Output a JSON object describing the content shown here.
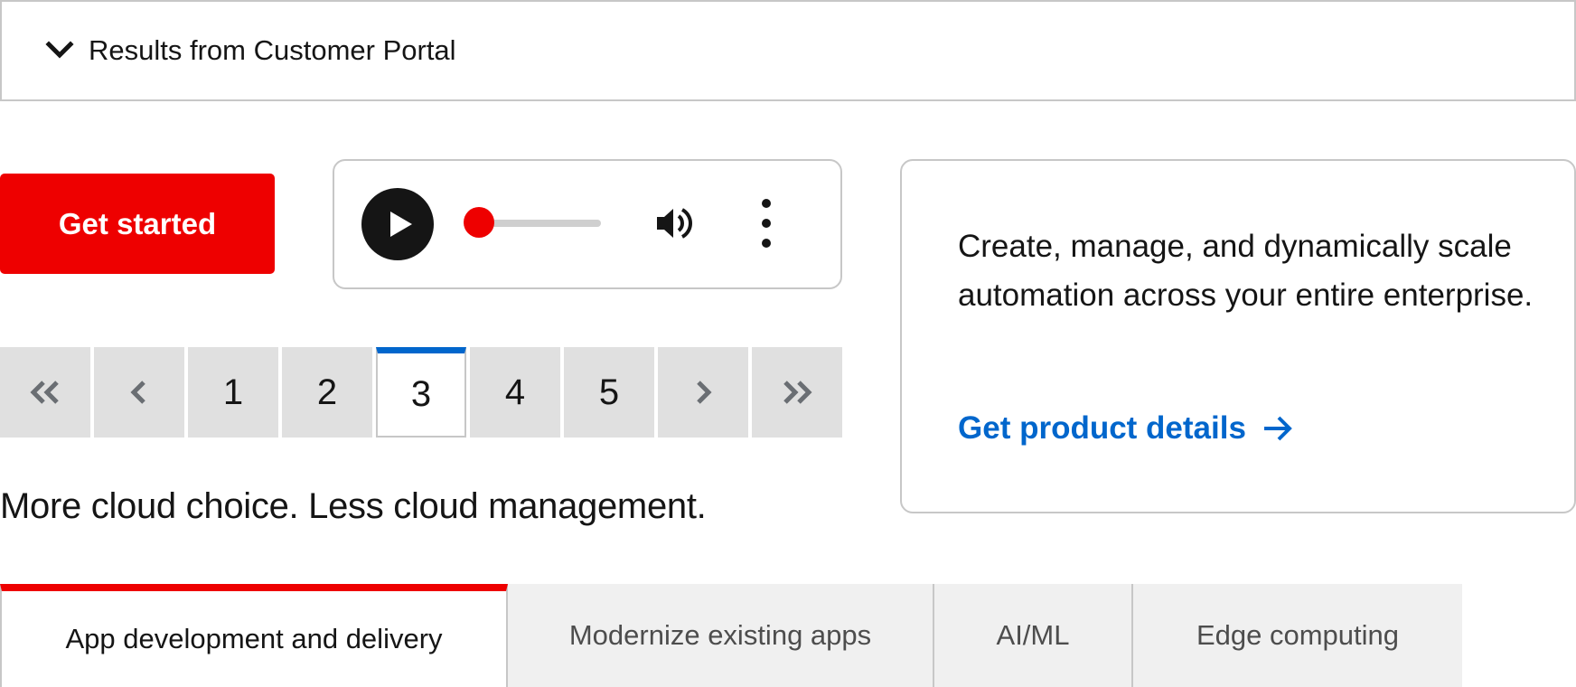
{
  "accordion": {
    "title": "Results from Customer Portal",
    "icon": "chevron-down-icon"
  },
  "cta": {
    "label": "Get started",
    "color": "#ee0000"
  },
  "player": {
    "progress": 0.1,
    "icons": [
      "play-icon",
      "volume-icon",
      "kebab-menu-icon"
    ]
  },
  "pagination": {
    "first_icon": "double-chevron-left-icon",
    "prev_icon": "chevron-left-icon",
    "pages": [
      "1",
      "2",
      "3",
      "4",
      "5"
    ],
    "current": "3",
    "next_icon": "chevron-right-icon",
    "last_icon": "double-chevron-right-icon",
    "accent": "#0066cc"
  },
  "headline": "More cloud choice. Less cloud management.",
  "card": {
    "text": "Create, manage, and dynamically scale automation across your entire enterprise.",
    "link": "Get product details",
    "link_color": "#0066cc"
  },
  "tabs": {
    "items": [
      {
        "label": "App development and delivery",
        "active": true
      },
      {
        "label": "Modernize existing apps",
        "active": false
      },
      {
        "label": "AI/ML",
        "active": false
      },
      {
        "label": "Edge computing",
        "active": false
      }
    ],
    "accent": "#ee0000"
  }
}
